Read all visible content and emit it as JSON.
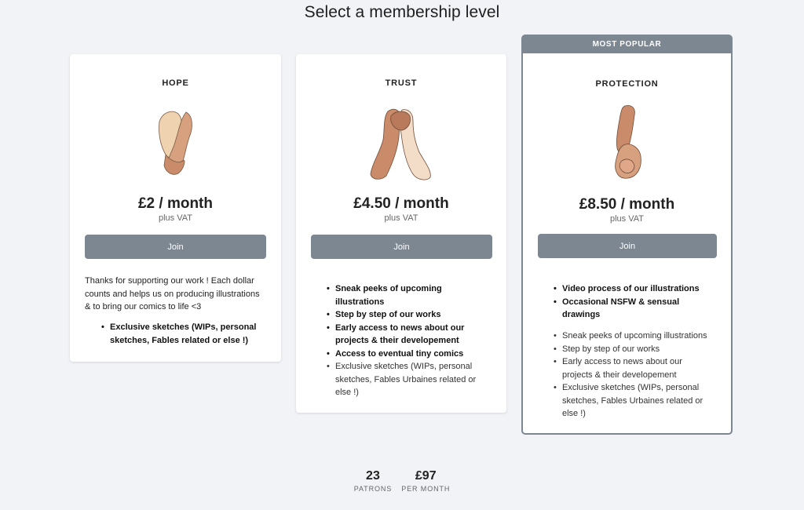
{
  "page": {
    "title": "Select a membership level"
  },
  "tiers": [
    {
      "name": "HOPE",
      "price": "£2 / month",
      "vat": "plus VAT",
      "join_label": "Join",
      "description": "Thanks for supporting our work ! Each dollar counts and helps us on producing illustrations & to bring our comics to life <3",
      "perks_bold": [
        "Exclusive sketches (WIPs, personal sketches, Fables related or else !)"
      ],
      "perks_plain": []
    },
    {
      "name": "TRUST",
      "price": "£4.50 / month",
      "vat": "plus VAT",
      "join_label": "Join",
      "perks_bold": [
        "Sneak peeks of upcoming illustrations",
        "Step by step of our works",
        "Early access to news about our projects & their developement",
        "Access to eventual tiny comics"
      ],
      "perks_plain": [
        "Exclusive sketches (WIPs, personal sketches, Fables Urbaines related or else !)"
      ]
    },
    {
      "banner": "MOST POPULAR",
      "name": "PROTECTION",
      "price": "£8.50 / month",
      "vat": "plus VAT",
      "join_label": "Join",
      "perks_bold": [
        "Video process of our illustrations",
        "Occasional NSFW & sensual drawings"
      ],
      "perks_plain": [
        "Sneak peeks of upcoming illustrations",
        "Step by step of our works",
        "Early access to news about our projects & their developement",
        "Exclusive sketches (WIPs, personal sketches, Fables Urbaines related or else !)"
      ]
    }
  ],
  "stats": [
    {
      "value": "23",
      "label": "PATRONS"
    },
    {
      "value": "£97",
      "label": "PER MONTH"
    }
  ],
  "colors": {
    "accent": "#7c8792",
    "background": "#f2f3f7",
    "skin_light": "#efd2b0",
    "skin_medium": "#d7a07e",
    "skin_dark": "#a86a4a"
  }
}
